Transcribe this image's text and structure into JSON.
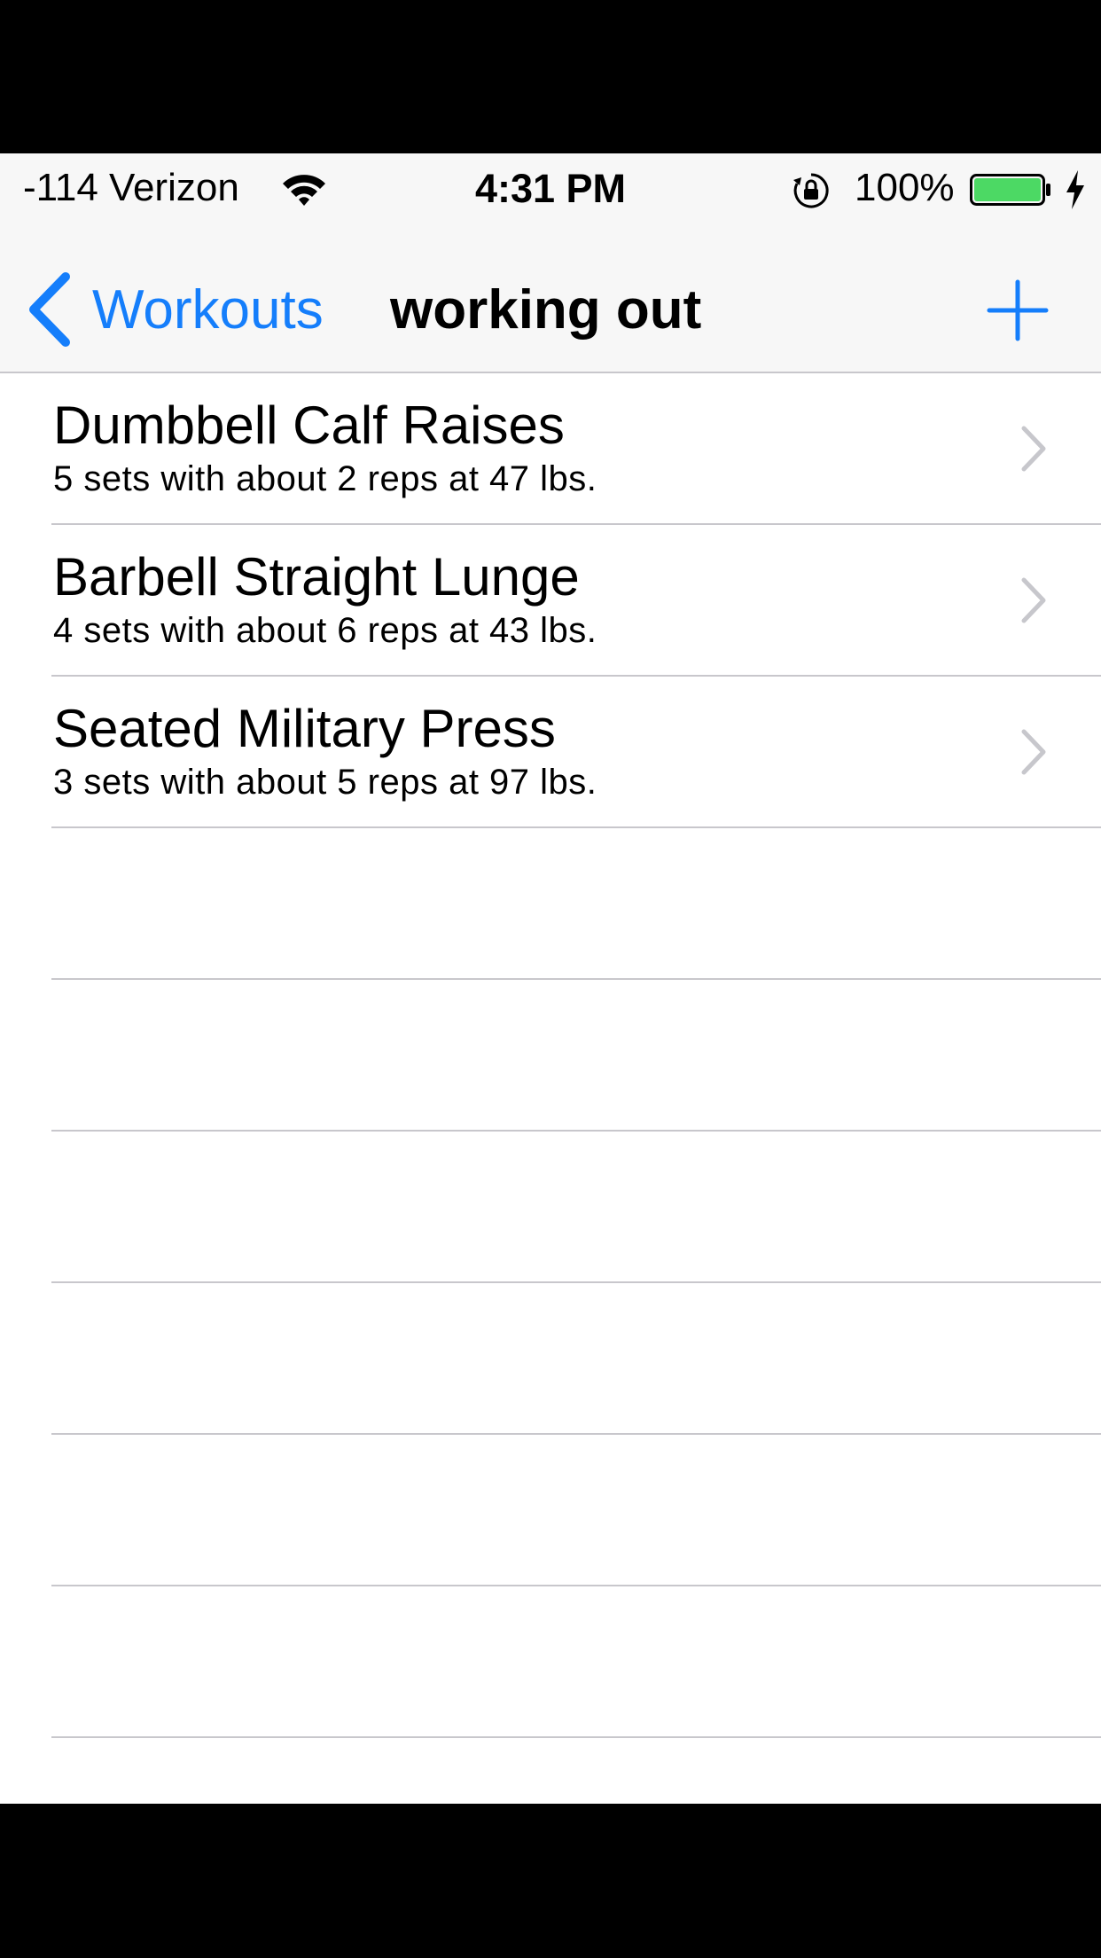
{
  "status_bar": {
    "carrier": "-114 Verizon",
    "time": "4:31 PM",
    "battery_percent": "100%",
    "battery_level": 1.0,
    "icons": [
      "wifi-icon",
      "rotation-lock-icon",
      "battery-icon",
      "charging-icon"
    ]
  },
  "nav": {
    "back_label": "Workouts",
    "title": "working out",
    "add_icon": "plus-icon"
  },
  "colors": {
    "accent": "#157efb",
    "battery": "#4cd964",
    "separator": "#c8c7cc",
    "chevron": "#c7c7cc"
  },
  "exercises": [
    {
      "name": "Dumbbell Calf Raises",
      "detail": "5 sets with about 2 reps at 47 lbs."
    },
    {
      "name": "Barbell Straight Lunge",
      "detail": "4 sets with about 6 reps at 43 lbs."
    },
    {
      "name": "Seated Military Press",
      "detail": "3 sets with about 5 reps at 97 lbs."
    }
  ]
}
